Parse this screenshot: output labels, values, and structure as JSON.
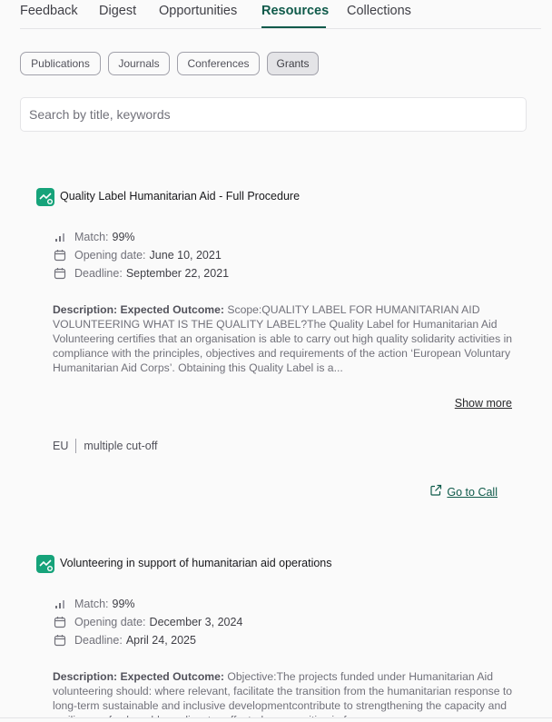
{
  "nav": {
    "tabs": [
      {
        "label": "Feedback"
      },
      {
        "label": "Digest"
      },
      {
        "label": "Opportunities"
      },
      {
        "label": "Resources",
        "active": true
      },
      {
        "label": "Collections"
      }
    ]
  },
  "filters": {
    "chips": [
      {
        "label": "Publications"
      },
      {
        "label": "Journals"
      },
      {
        "label": "Conferences"
      },
      {
        "label": "Grants",
        "selected": true
      }
    ]
  },
  "search": {
    "placeholder": "Search by title, keywords"
  },
  "meta_labels": {
    "match": "Match:",
    "opening": "Opening date:",
    "deadline": "Deadline:",
    "description": "Description:"
  },
  "actions": {
    "show_more": "Show more",
    "go_to_call": "Go to Call"
  },
  "grants": [
    {
      "title": "Quality Label Humanitarian Aid - Full Procedure",
      "match": "99%",
      "opening_date": "June 10, 2021",
      "deadline": "September 22, 2021",
      "desc_lead": "Expected Outcome:",
      "desc_text": "Scope:QUALITY LABEL FOR HUMANITARIAN AID VOLUNTEERING WHAT IS THE QUALITY LABEL?The Quality Label for Humanitarian Aid Volunteering certifies that an organisation is able to carry out high quality solidarity activities in compliance with the principles, objectives and requirements of the action ‘European Voluntary Humanitarian Aid Corps’. Obtaining this Quality Label is a...",
      "region": "EU",
      "cutoff": "multiple cut-off"
    },
    {
      "title": "Volunteering in support of humanitarian aid operations",
      "match": "99%",
      "opening_date": "December 3, 2024",
      "deadline": "April 24, 2025",
      "desc_lead": "Expected Outcome:",
      "desc_text": "Objective:The projects funded under Humanitarian Aid volunteering should: where relevant, facilitate the transition from the humanitarian response to long-term sustainable and inclusive developmentcontribute to strengthening the capacity and resilience of vulnerable or disaster-affected communities in four..."
    }
  ],
  "colors": {
    "accent": "#0f5a4a",
    "icon_bg": "#16a37a"
  },
  "icons": {
    "match": "signal-bars-icon",
    "date": "calendar-icon",
    "grant": "chart-badge-icon",
    "external": "external-link-icon"
  }
}
